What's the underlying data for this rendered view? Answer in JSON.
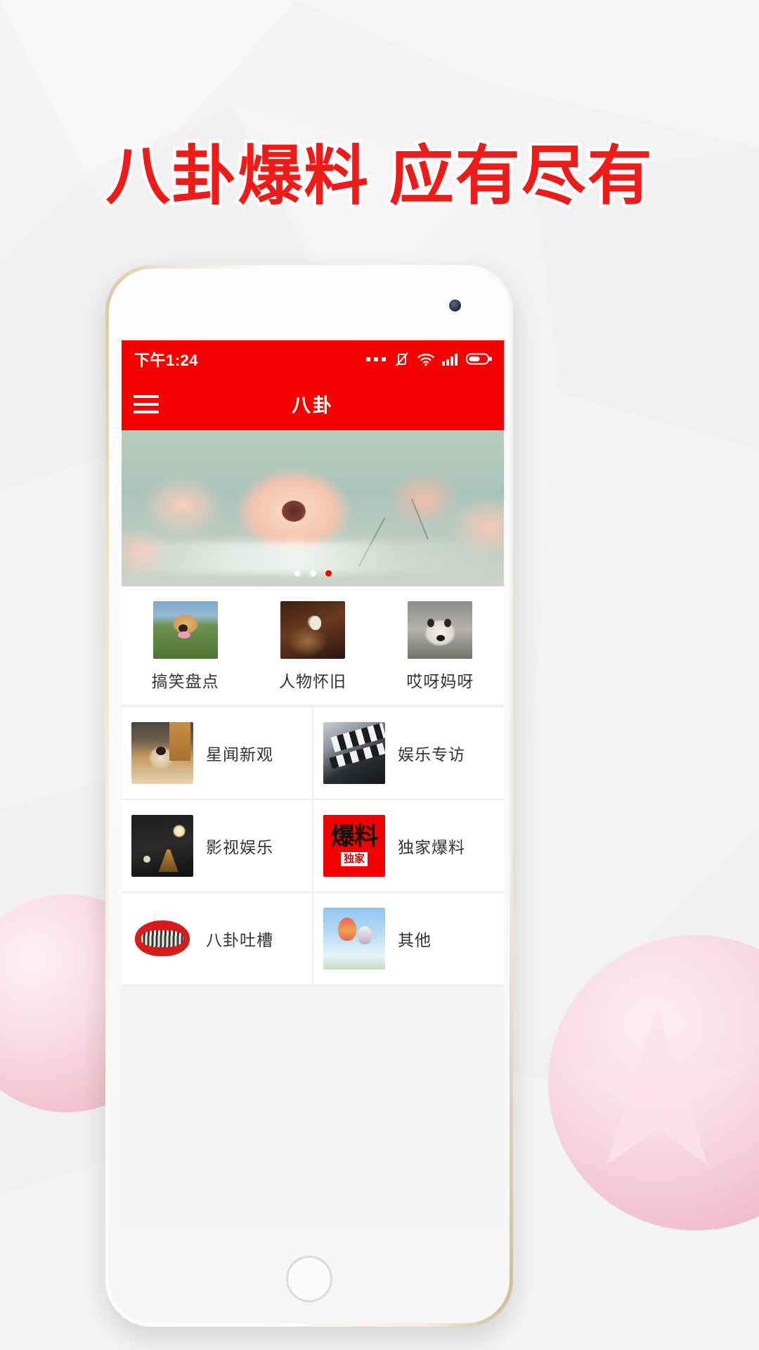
{
  "poster": {
    "headline": "八卦爆料 应有尽有",
    "headline_color": "#ee1b18"
  },
  "phone": {
    "status_bar": {
      "time": "下午1:24",
      "accent_color": "#f90000",
      "icons": [
        "more-dots-icon",
        "vibrate-off-icon",
        "wifi-icon",
        "signal-icon",
        "battery-icon"
      ]
    },
    "nav_bar": {
      "menu_icon": "hamburger-menu-icon",
      "title": "八卦"
    },
    "banner": {
      "image_alt": "flower-banner",
      "dot_count": 3,
      "active_dot": 2,
      "active_dot_color": "#f40000"
    },
    "top_categories": [
      {
        "label": "搞笑盘点",
        "thumb": "shiba-grass-thumb",
        "thumb_class": "t-shiba-grass"
      },
      {
        "label": "人物怀旧",
        "thumb": "dark-figure-thumb",
        "thumb_class": "t-dark-fig"
      },
      {
        "label": "哎呀妈呀",
        "thumb": "husky-thumb",
        "thumb_class": "t-husky"
      }
    ],
    "grid_rows": [
      [
        {
          "label": "星闻新观",
          "thumb": "shiba-floor-thumb",
          "thumb_class": "t-shiba-floor"
        },
        {
          "label": "娱乐专访",
          "thumb": "clapperboard-thumb",
          "thumb_class": "t-clapper"
        }
      ],
      [
        {
          "label": "影视娱乐",
          "thumb": "stage-lights-thumb",
          "thumb_class": "t-stage"
        },
        {
          "label": "独家爆料",
          "thumb": "baoliao-red-thumb",
          "thumb_class": "t-baoliao",
          "thumb_text": {
            "main": "爆料",
            "sub": "独家"
          }
        }
      ],
      [
        {
          "label": "八卦吐槽",
          "thumb": "red-lips-thumb",
          "thumb_class": "t-lips"
        },
        {
          "label": "其他",
          "thumb": "hot-air-balloon-thumb",
          "thumb_class": "t-balloon"
        }
      ]
    ],
    "home_button": "home-button"
  }
}
